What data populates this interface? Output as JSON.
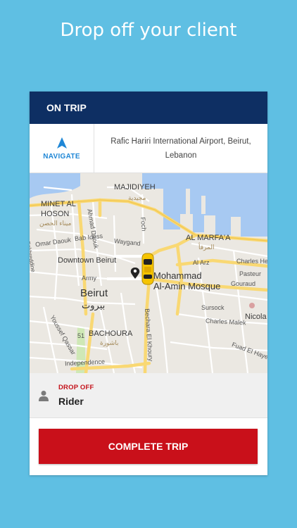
{
  "promo": {
    "headline": "Drop off your client"
  },
  "topbar": {
    "title": "ON TRIP"
  },
  "navigate": {
    "label": "NAVIGATE",
    "icon": "navigation-arrow-icon"
  },
  "destination": {
    "address": "Rafic Hariri International Airport, Beirut, Lebanon"
  },
  "map": {
    "labels": {
      "majidiyeh": "MAJIDIYEH",
      "majidiyeh_ar": "مجيدية",
      "minet_al": "MINET AL",
      "hoson": "HOSON",
      "minet_ar": "ميناء الحصن",
      "omar_daouk": "Omar Daouk",
      "bab_idriss": "Bab Idriss",
      "ahmad_daouk": "Ahmad Daouk",
      "waygand": "Waygand",
      "foch": "Foch",
      "al_marfaa": "AL MARFA'A",
      "al_marfaa_ar": "المرفأ",
      "downtown": "Downtown Beirut",
      "al_arz": "Al Arz",
      "charles_helou": "Charles Helou",
      "pasteur": "Pasteur",
      "mohammad": "Mohammad",
      "mosque": "Al-Amin Mosque",
      "army": "Army",
      "gouraud": "Gouraud",
      "beirut": "Beirut",
      "beirut_ar": "بيروت",
      "sursock": "Sursock",
      "nicola": "Nicola",
      "charles_malek": "Charles Malek",
      "bachoura": "BACHOURA",
      "bachoura_ar": "باشورة",
      "bechara": "Bechara El Khoury",
      "youssef_kassar": "Youssef Qassar",
      "independence": "Independence",
      "fuad_hayek": "Fuad El Hayek",
      "fakhreddine": "Fakhreddine",
      "route51": "51"
    },
    "colors": {
      "water": "#a7c9f2",
      "land": "#ebe8e2",
      "road": "#ffffff",
      "highway": "#f9d873",
      "park": "#cfe8b6"
    }
  },
  "dropoff": {
    "label": "DROP OFF",
    "name": "Rider"
  },
  "action": {
    "complete_label": "COMPLETE TRIP"
  }
}
